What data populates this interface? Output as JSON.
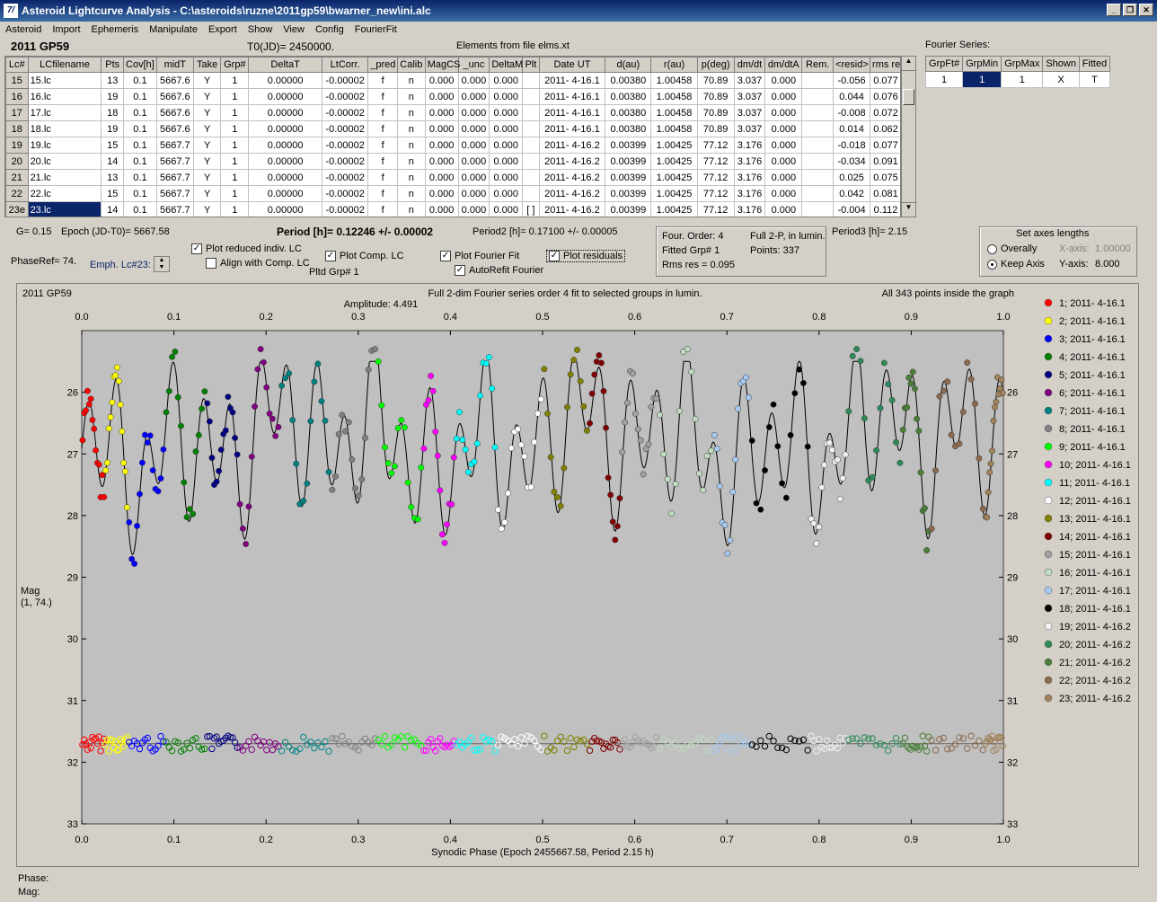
{
  "window": {
    "title": "Asteroid Lightcurve Analysis - C:\\asteroids\\ruzne\\2011gp59\\bwarner_new\\ini.alc",
    "icon": "7/"
  },
  "menu": [
    "Asteroid",
    "Import",
    "Ephemeris",
    "Manipulate",
    "Export",
    "Show",
    "View",
    "Config",
    "FourierFit"
  ],
  "header": {
    "object": "2011 GP59",
    "t0": "T0(JD)= 2450000.",
    "elements": "Elements from file elms.xt"
  },
  "table": {
    "columns": [
      "Lc#",
      "LCfilename",
      "Pts",
      "Cov[h]",
      "midT",
      "Take",
      "Grp#",
      "DeltaT",
      "LtCorr.",
      "_pred",
      "Calib",
      "MagCS",
      "_unc",
      "DeltaM",
      "Plt",
      "Date UT",
      "d(au)",
      "r(au)",
      "p(deg)",
      "dm/dt",
      "dm/dtA",
      "Rem.",
      "<resid>",
      "rms res"
    ],
    "rows": [
      [
        "15",
        "15.lc",
        "13",
        "0.1",
        "5667.6",
        "Y",
        "1",
        "0.00000",
        "-0.00002",
        "f",
        "n",
        "0.000",
        "0.000",
        "0.000",
        "",
        "2011- 4-16.1",
        "0.00380",
        "1.00458",
        "70.89",
        "3.037",
        "0.000",
        "",
        "-0.056",
        "0.077"
      ],
      [
        "16",
        "16.lc",
        "19",
        "0.1",
        "5667.6",
        "Y",
        "1",
        "0.00000",
        "-0.00002",
        "f",
        "n",
        "0.000",
        "0.000",
        "0.000",
        "",
        "2011- 4-16.1",
        "0.00380",
        "1.00458",
        "70.89",
        "3.037",
        "0.000",
        "",
        "0.044",
        "0.076"
      ],
      [
        "17",
        "17.lc",
        "18",
        "0.1",
        "5667.6",
        "Y",
        "1",
        "0.00000",
        "-0.00002",
        "f",
        "n",
        "0.000",
        "0.000",
        "0.000",
        "",
        "2011- 4-16.1",
        "0.00380",
        "1.00458",
        "70.89",
        "3.037",
        "0.000",
        "",
        "-0.008",
        "0.072"
      ],
      [
        "18",
        "18.lc",
        "19",
        "0.1",
        "5667.6",
        "Y",
        "1",
        "0.00000",
        "-0.00002",
        "f",
        "n",
        "0.000",
        "0.000",
        "0.000",
        "",
        "2011- 4-16.1",
        "0.00380",
        "1.00458",
        "70.89",
        "3.037",
        "0.000",
        "",
        "0.014",
        "0.062"
      ],
      [
        "19",
        "19.lc",
        "15",
        "0.1",
        "5667.7",
        "Y",
        "1",
        "0.00000",
        "-0.00002",
        "f",
        "n",
        "0.000",
        "0.000",
        "0.000",
        "",
        "2011- 4-16.2",
        "0.00399",
        "1.00425",
        "77.12",
        "3.176",
        "0.000",
        "",
        "-0.018",
        "0.077"
      ],
      [
        "20",
        "20.lc",
        "14",
        "0.1",
        "5667.7",
        "Y",
        "1",
        "0.00000",
        "-0.00002",
        "f",
        "n",
        "0.000",
        "0.000",
        "0.000",
        "",
        "2011- 4-16.2",
        "0.00399",
        "1.00425",
        "77.12",
        "3.176",
        "0.000",
        "",
        "-0.034",
        "0.091"
      ],
      [
        "21",
        "21.lc",
        "13",
        "0.1",
        "5667.7",
        "Y",
        "1",
        "0.00000",
        "-0.00002",
        "f",
        "n",
        "0.000",
        "0.000",
        "0.000",
        "",
        "2011- 4-16.2",
        "0.00399",
        "1.00425",
        "77.12",
        "3.176",
        "0.000",
        "",
        "0.025",
        "0.075"
      ],
      [
        "22",
        "22.lc",
        "15",
        "0.1",
        "5667.7",
        "Y",
        "1",
        "0.00000",
        "-0.00002",
        "f",
        "n",
        "0.000",
        "0.000",
        "0.000",
        "",
        "2011- 4-16.2",
        "0.00399",
        "1.00425",
        "77.12",
        "3.176",
        "0.000",
        "",
        "0.042",
        "0.081"
      ],
      [
        "23e",
        "23.lc",
        "14",
        "0.1",
        "5667.7",
        "Y",
        "1",
        "0.00000",
        "-0.00002",
        "f",
        "n",
        "0.000",
        "0.000",
        "0.000",
        "[ ]",
        "2011- 4-16.2",
        "0.00399",
        "1.00425",
        "77.12",
        "3.176",
        "0.000",
        "",
        "-0.004",
        "0.112"
      ]
    ]
  },
  "fourier_series": {
    "title": "Fourier Series:",
    "columns": [
      "GrpFt#",
      "GrpMin",
      "GrpMax",
      "Shown",
      "Fitted"
    ],
    "row": [
      "1",
      "1",
      "1",
      "X",
      "T"
    ]
  },
  "info": {
    "g": "G= 0.15",
    "epoch": "Epoch (JD-T0)= 5667.58",
    "period": "Period [h]= 0.12246 +/- 0.00002",
    "period2": "Period2 [h]= 0.17100 +/- 0.00005",
    "period3": "Period3 [h]= 2.15",
    "phaseref": "PhaseRef= 74.",
    "emph": "Emph. Lc#23:",
    "plot_reduced": "Plot reduced indiv. LC",
    "align": "Align with Comp. LC",
    "plot_comp": "Plot Comp. LC",
    "pltd_grp": "Pltd Grp#  1",
    "plot_fourier": "Plot Fourier Fit",
    "autorefit": "AutoRefit Fourier",
    "plot_residuals": "Plot residuals",
    "four_order": "Four. Order:  4",
    "fitted_grp": "Fitted Grp# 1",
    "rms": "Rms res    = 0.095",
    "full2p": "Full 2-P, in lumin.",
    "points": "Points: 337",
    "axes_title": "Set axes lengths",
    "overally": "Overally",
    "keep_axis": "Keep Axis",
    "xaxis_label": "X-axis:",
    "xaxis_val": "1.00000",
    "yaxis_label": "Y-axis:",
    "yaxis_val": "8.000"
  },
  "chart_data": {
    "type": "scatter",
    "title": "Full 2-dim Fourier series order 4 fit to selected groups in lumin.",
    "subtitle": "Amplitude: 4.491",
    "top_left": "2011 GP59",
    "top_right": "All 343 points inside the graph",
    "xlabel": "Synodic Phase (Epoch 2455667.58, Period 2.15 h)",
    "ylabel": "Mag",
    "ylabel2": "(1, 74.)",
    "xlim": [
      0,
      1
    ],
    "ylim": [
      25,
      33
    ],
    "x_ticks": [
      "0.0",
      "0.1",
      "0.2",
      "0.3",
      "0.4",
      "0.5",
      "0.6",
      "0.7",
      "0.8",
      "0.9",
      "1.0"
    ],
    "y_ticks": [
      "26",
      "27",
      "28",
      "29",
      "30",
      "31",
      "32",
      "33"
    ],
    "residual_baseline": 31.7,
    "legend": [
      {
        "label": "1; 2011- 4-16.1",
        "color": "#ff0000",
        "x0": 0.0,
        "x1": 0.025
      },
      {
        "label": "2; 2011- 4-16.1",
        "color": "#ffff00",
        "x0": 0.025,
        "x1": 0.05
      },
      {
        "label": "3; 2011- 4-16.1",
        "color": "#0000ff",
        "x0": 0.05,
        "x1": 0.09
      },
      {
        "label": "4; 2011- 4-16.1",
        "color": "#008000",
        "x0": 0.09,
        "x1": 0.135
      },
      {
        "label": "5; 2011- 4-16.1",
        "color": "#000080",
        "x0": 0.135,
        "x1": 0.17
      },
      {
        "label": "6; 2011- 4-16.1",
        "color": "#800080",
        "x0": 0.17,
        "x1": 0.215
      },
      {
        "label": "7; 2011- 4-16.1",
        "color": "#008080",
        "x0": 0.215,
        "x1": 0.27
      },
      {
        "label": "8; 2011- 4-16.1",
        "color": "#808080",
        "x0": 0.27,
        "x1": 0.32
      },
      {
        "label": "9; 2011- 4-16.1",
        "color": "#00ff00",
        "x0": 0.32,
        "x1": 0.37
      },
      {
        "label": "10; 2011- 4-16.1",
        "color": "#ff00ff",
        "x0": 0.37,
        "x1": 0.405
      },
      {
        "label": "11; 2011- 4-16.1",
        "color": "#00ffff",
        "x0": 0.405,
        "x1": 0.45
      },
      {
        "label": "12; 2011- 4-16.1",
        "color": "#ffffff",
        "x0": 0.45,
        "x1": 0.5
      },
      {
        "label": "13; 2011- 4-16.1",
        "color": "#808000",
        "x0": 0.5,
        "x1": 0.55
      },
      {
        "label": "14; 2011- 4-16.1",
        "color": "#800000",
        "x0": 0.55,
        "x1": 0.585
      },
      {
        "label": "15; 2011- 4-16.1",
        "color": "#a0a0a0",
        "x0": 0.585,
        "x1": 0.625
      },
      {
        "label": "16; 2011- 4-16.1",
        "color": "#c0dcc0",
        "x0": 0.625,
        "x1": 0.685
      },
      {
        "label": "17; 2011- 4-16.1",
        "color": "#a6caf0",
        "x0": 0.685,
        "x1": 0.725
      },
      {
        "label": "18; 2011- 4-16.1",
        "color": "#000000",
        "x0": 0.725,
        "x1": 0.79
      },
      {
        "label": "19; 2011- 4-16.2",
        "color": "#f0f0f0",
        "x0": 0.79,
        "x1": 0.83
      },
      {
        "label": "20; 2011- 4-16.2",
        "color": "#2e8b57",
        "x0": 0.83,
        "x1": 0.89
      },
      {
        "label": "21; 2011- 4-16.2",
        "color": "#4a7f3a",
        "x0": 0.89,
        "x1": 0.92
      },
      {
        "label": "22; 2011- 4-16.2",
        "color": "#8b6a4f",
        "x0": 0.92,
        "x1": 0.98
      },
      {
        "label": "23; 2011- 4-16.2",
        "color": "#a0825a",
        "x0": 0.98,
        "x1": 1.0
      }
    ]
  },
  "status": {
    "phase": "Phase:",
    "mag": "Mag:"
  }
}
